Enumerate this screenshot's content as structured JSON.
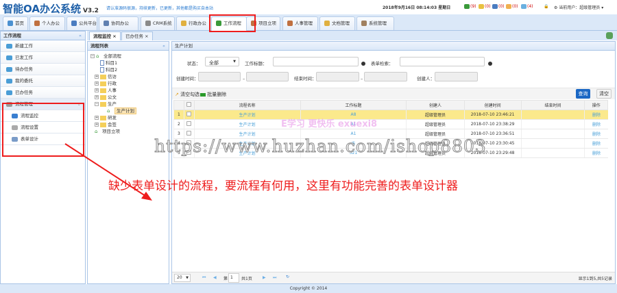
{
  "header": {
    "logo": "智能OA办公系统",
    "version": "V3.2",
    "notice": "请认准源码很源，持续更新，已更新，其他都是购买自本站",
    "datetime": "2018年9月16日 08:14:03 星期日",
    "indicators": [
      {
        "icon": "user-icon",
        "count": "(9)",
        "color": "#3a9a3a"
      },
      {
        "icon": "mail-icon",
        "count": "(0)",
        "color": "#e8c040"
      },
      {
        "icon": "calendar-icon",
        "count": "(0)",
        "color": "#4a7cc0"
      },
      {
        "icon": "chat-icon",
        "count": "(0)",
        "color": "#f0b050"
      },
      {
        "icon": "message-icon",
        "count": "(4)",
        "color": "#6ab0e0"
      }
    ],
    "current_user": "当前用户：超级管理员"
  },
  "nav_tabs": [
    {
      "label": "首页"
    },
    {
      "label": "个人办公"
    },
    {
      "label": "公共平台"
    },
    {
      "label": "协同办公"
    },
    {
      "label": "CRM系统"
    },
    {
      "label": "行政办公"
    },
    {
      "label": "工作流程",
      "active": true
    },
    {
      "label": "项目立项"
    },
    {
      "label": "人事管理"
    },
    {
      "label": "文档管理"
    },
    {
      "label": "系统管理"
    }
  ],
  "sidebar": {
    "title": "工作流程",
    "items": [
      "新建工作",
      "已发工作",
      "待办任务",
      "我的委托",
      "已办任务"
    ],
    "group": "流程管理",
    "sub_items": [
      "流程监控",
      "流程设置",
      "表单设计"
    ]
  },
  "work_tabs": [
    "流程监控 ×",
    "已办任务 ×"
  ],
  "tree": {
    "title": "流程列表",
    "nodes": [
      "全部流程",
      "科目1",
      "科目2",
      "信访",
      "行政",
      "人事",
      "公文",
      "生产",
      "生产计划",
      "研发",
      "会签",
      "项目立项"
    ]
  },
  "main": {
    "title": "生产计划",
    "filters": {
      "status_label": "状态：",
      "status_value": "全部",
      "work_title_label": "工作标题：",
      "form_search_label": "表单检索：",
      "create_time_label": "创建时间：",
      "end_time_label": "结束时间：",
      "creator_label": "创建人：",
      "dash": "–"
    },
    "toolbar": {
      "clear": "清空勾选",
      "batch_delete": "批量删除",
      "search": "查询",
      "reset": "清空"
    },
    "columns": [
      "流程名称",
      "工作标题",
      "创建人",
      "创建时间",
      "结束时间",
      "操作"
    ],
    "rows": [
      {
        "n": "1",
        "name": "生产计划",
        "title": "A8",
        "creator": "超级管理员",
        "created": "2018-07-10 23:46:21",
        "ended": "",
        "op": "删除"
      },
      {
        "n": "2",
        "name": "生产计划",
        "title": "A1",
        "creator": "超级管理员",
        "created": "2018-07-10 23:38:29",
        "ended": "",
        "op": "删除"
      },
      {
        "n": "3",
        "name": "生产计划",
        "title": "A1",
        "creator": "超级管理员",
        "created": "2018-07-10 23:36:51",
        "ended": "",
        "op": "删除"
      },
      {
        "n": "4",
        "name": "生产计划",
        "title": "丰",
        "creator": "超级管理员",
        "created": "2018-07-10 23:30:45",
        "ended": "",
        "op": "删除"
      },
      {
        "n": "5",
        "name": "生产计划",
        "title": "321",
        "creator": "超级管理员",
        "created": "2018-07-10 23:29:48",
        "ended": "",
        "op": "删除"
      }
    ],
    "pager": {
      "page_size": "20",
      "page_prefix": "第",
      "page": "1",
      "total_pages": "共1页",
      "summary": "显示1到5,共5记录"
    }
  },
  "footer": "Copyright © 2014",
  "annotation": "缺少表单设计的流程，要流程有何用，这里有功能完善的表单设计器",
  "watermarks": [
    "https://www.huzhan.com/ishop8803",
    "E学习 更快乐 exuexi8"
  ]
}
